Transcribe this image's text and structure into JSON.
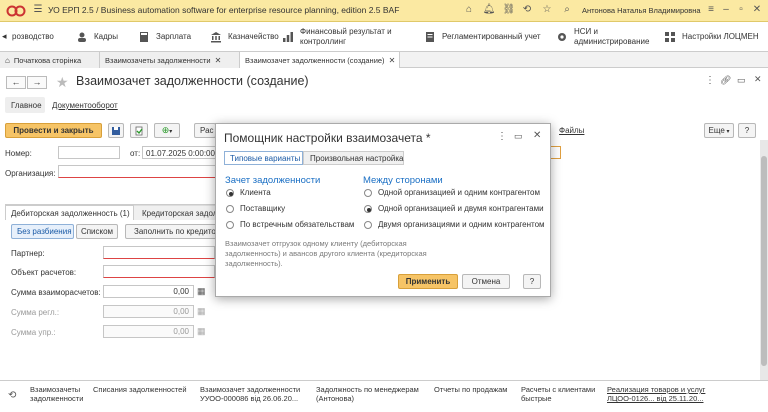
{
  "topbar": {
    "title": "УО ЕРП 2.5 / Business automation software for enterprise resource planning, edition 2.5 BAF",
    "user": "Антонова Наталья Владимировна"
  },
  "sections": [
    {
      "label": "розводство"
    },
    {
      "label": "Кадры"
    },
    {
      "label": "Зарплата"
    },
    {
      "label": "Казначейство"
    },
    {
      "label": "Финансовый результат и контроллинг"
    },
    {
      "label": "Регламентированный учет"
    },
    {
      "label": "НСИ и администрирование"
    },
    {
      "label": "Настройки ЛОЦМЕН"
    }
  ],
  "open_tabs": [
    {
      "label": "Початкова сторінка"
    },
    {
      "label": "Взаимозачеты задолженности"
    },
    {
      "label": "Взаимозачет задолженности (создание)"
    }
  ],
  "doc": {
    "title": "Взаимозачет задолженности (создание)",
    "subnav_main": "Главное",
    "subnav_docflow": "Документооборот",
    "post_close": "Провести и закрыть",
    "more": "Еще",
    "help": "?",
    "files_link": "Файлы",
    "partial_btn": "Рас",
    "number_label": "Номер:",
    "date_label": "от:",
    "date_value": "01.07.2025  0:00:00",
    "org_label": "Организация:",
    "tab_debit": "Дебиторская задолженность (1)",
    "tab_credit": "Кредиторская задол",
    "btn_no_split": "Без разбиения",
    "btn_list": "Списком",
    "btn_fill": "Заполнить по кредито",
    "partner_label": "Партнер:",
    "settlement_label": "Объект расчетов:",
    "sum_label": "Сумма взаиморасчетов:",
    "sum_value": "0,00",
    "sum_reg_label": "Сумма регл.:",
    "sum_reg_value": "0,00",
    "sum_mgmt_label": "Сумма упр.:",
    "sum_mgmt_value": "0,00"
  },
  "modal": {
    "title": "Помощник настройки взаимозачета *",
    "tab_typical": "Типовые варианты",
    "tab_custom": "Произвольная настройка",
    "group1_title": "Зачет задолженности",
    "group1_options": [
      "Клиента",
      "Поставщику",
      "По встречным обязательствам"
    ],
    "group1_selected": 0,
    "group2_title": "Между сторонами",
    "group2_options": [
      "Одной организацией и одним контрагентом",
      "Одной организацией и двумя контрагентами",
      "Двумя организациями и одним контрагентом"
    ],
    "group2_selected": 1,
    "description": "Взаимозачет отгрузок одному клиенту (дебиторская задолженность) и авансов другого клиента (кредиторская задолженность).",
    "apply": "Применить",
    "cancel": "Отмена",
    "help": "?"
  },
  "bottom_links": [
    {
      "line1": "Взаимозачеты",
      "line2": "задолженности"
    },
    {
      "line1": "Списания задолженностей",
      "line2": ""
    },
    {
      "line1": "Взаимозачет задолженности",
      "line2": "УУОО-000086 від 26.06.20..."
    },
    {
      "line1": "Задолжность по менеджерам",
      "line2": "(Антонова)"
    },
    {
      "line1": "Отчеты по продажам",
      "line2": ""
    },
    {
      "line1": "Расчеты с клиентами",
      "line2": "быстрые"
    },
    {
      "line1": "Реализация товаров и услуг",
      "line2": "ЛЦОО-0126... від 25.11.20..."
    }
  ],
  "colors": {
    "accent": "#f6c466",
    "topbar": "#fbe9a2",
    "link": "#1a5aa6",
    "modal_heading": "#1a6fc4"
  }
}
